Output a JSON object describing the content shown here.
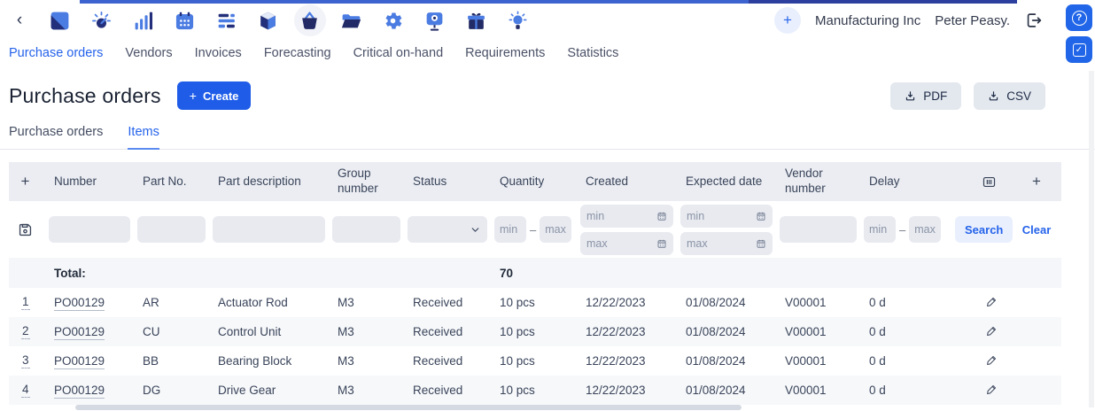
{
  "topbar": {
    "back": "‹",
    "apps": [
      {
        "name": "logo"
      },
      {
        "name": "gauge"
      },
      {
        "name": "bar-chart"
      },
      {
        "name": "calendar"
      },
      {
        "name": "gantt"
      },
      {
        "name": "cube"
      },
      {
        "name": "basket",
        "selected": true
      },
      {
        "name": "folder"
      },
      {
        "name": "gear"
      },
      {
        "name": "board"
      },
      {
        "name": "gift"
      },
      {
        "name": "lightbulb"
      }
    ],
    "add_label": "+",
    "company": "Manufacturing Inc",
    "user": "Peter Peasy.",
    "help_label": "?",
    "tasks_check": "✓"
  },
  "nav": {
    "items": [
      {
        "label": "Purchase orders",
        "active": true
      },
      {
        "label": "Vendors"
      },
      {
        "label": "Invoices"
      },
      {
        "label": "Forecasting"
      },
      {
        "label": "Critical on-hand"
      },
      {
        "label": "Requirements"
      },
      {
        "label": "Statistics"
      }
    ]
  },
  "page": {
    "title": "Purchase orders",
    "create_plus": "+",
    "create": "Create",
    "pdf": "PDF",
    "csv": "CSV"
  },
  "tabs": [
    {
      "label": "Purchase orders"
    },
    {
      "label": "Items",
      "active": true
    }
  ],
  "table": {
    "add_row": "+",
    "add_col": "+",
    "columns": [
      "Number",
      "Part No.",
      "Part description",
      "Group number",
      "Status",
      "Quantity",
      "Created",
      "Expected date",
      "Vendor number",
      "Delay"
    ],
    "filters": {
      "min": "min",
      "max": "max",
      "dash": "–",
      "search": "Search",
      "clear": "Clear"
    },
    "total": {
      "label": "Total:",
      "quantity": "70"
    },
    "rows": [
      {
        "index": "1",
        "number": "PO00129",
        "part_no": "AR",
        "part_description": "Actuator Rod",
        "group_number": "M3",
        "status": "Received",
        "quantity": "10 pcs",
        "created": "12/22/2023",
        "expected_date": "01/08/2024",
        "vendor_number": "V00001",
        "delay": "0 d"
      },
      {
        "index": "2",
        "number": "PO00129",
        "part_no": "CU",
        "part_description": "Control Unit",
        "group_number": "M3",
        "status": "Received",
        "quantity": "10 pcs",
        "created": "12/22/2023",
        "expected_date": "01/08/2024",
        "vendor_number": "V00001",
        "delay": "0 d"
      },
      {
        "index": "3",
        "number": "PO00129",
        "part_no": "BB",
        "part_description": "Bearing Block",
        "group_number": "M3",
        "status": "Received",
        "quantity": "10 pcs",
        "created": "12/22/2023",
        "expected_date": "01/08/2024",
        "vendor_number": "V00001",
        "delay": "0 d"
      },
      {
        "index": "4",
        "number": "PO00129",
        "part_no": "DG",
        "part_description": "Drive Gear",
        "group_number": "M3",
        "status": "Received",
        "quantity": "10 pcs",
        "created": "12/22/2023",
        "expected_date": "01/08/2024",
        "vendor_number": "V00001",
        "delay": "0 d"
      }
    ]
  },
  "icons": {
    "back": "chevron-left",
    "export": "download-tray",
    "filter_save": "floppy-disk",
    "date": "calendar-small",
    "status_dropdown": "chevron-down",
    "columns": "columns-outline",
    "edit": "pencil",
    "logout": "door-arrow-right",
    "help": "question-circle",
    "tasks": "check-square"
  },
  "colors": {
    "accent": "#2563eb",
    "header_bg": "#ebedf2",
    "row_alt": "#f7f8fa",
    "top_strip": "#3d63cf"
  }
}
